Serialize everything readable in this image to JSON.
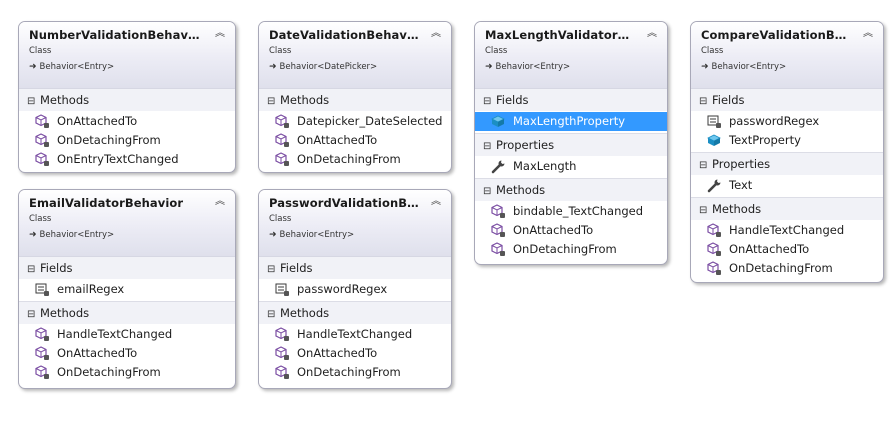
{
  "sections": {
    "methods": "Methods",
    "fields": "Fields",
    "properties": "Properties"
  },
  "icons": {
    "collapse": "double-chevron-up-icon",
    "base": "inheritance-arrow-icon",
    "method": "method-cube-icon",
    "field": "field-icon",
    "property": "wrench-icon"
  },
  "colors": {
    "method_icon": "#7b4ea3",
    "selection": "#3399ff",
    "field_icon": "#1b8fc4"
  },
  "classes": [
    {
      "name": "NumberValidationBehavior",
      "kind": "Class",
      "base": "Behavior<Entry>",
      "methods": [
        "OnAttachedTo",
        "OnDetachingFrom",
        "OnEntryTextChanged"
      ]
    },
    {
      "name": "DateValidationBehavior",
      "kind": "Class",
      "base": "Behavior<DatePicker>",
      "methods": [
        "Datepicker_DateSelected",
        "OnAttachedTo",
        "OnDetachingFrom"
      ]
    },
    {
      "name": "MaxLengthValidatorBeh...",
      "kind": "Class",
      "base": "Behavior<Entry>",
      "fields": [
        "MaxLengthProperty"
      ],
      "properties": [
        "MaxLength"
      ],
      "methods": [
        "bindable_TextChanged",
        "OnAttachedTo",
        "OnDetachingFrom"
      ]
    },
    {
      "name": "CompareValidationBeha...",
      "kind": "Class",
      "base": "Behavior<Entry>",
      "fields": [
        "passwordRegex",
        "TextProperty"
      ],
      "properties": [
        "Text"
      ],
      "methods": [
        "HandleTextChanged",
        "OnAttachedTo",
        "OnDetachingFrom"
      ]
    },
    {
      "name": "EmailValidatorBehavior",
      "kind": "Class",
      "base": "Behavior<Entry>",
      "fields": [
        "emailRegex"
      ],
      "methods": [
        "HandleTextChanged",
        "OnAttachedTo",
        "OnDetachingFrom"
      ]
    },
    {
      "name": "PasswordValidationBeha...",
      "kind": "Class",
      "base": "Behavior<Entry>",
      "fields": [
        "passwordRegex"
      ],
      "methods": [
        "HandleTextChanged",
        "OnAttachedTo",
        "OnDetachingFrom"
      ]
    }
  ]
}
